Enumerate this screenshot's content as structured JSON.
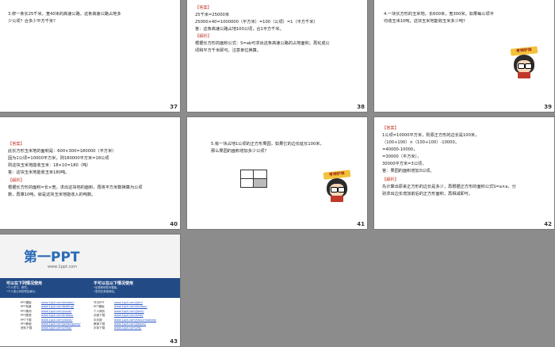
{
  "slides": [
    {
      "num": "37",
      "text": "3.修一条长25千米，宽40米的高速公路，这条高速公路占地多\n少公顷？合多少平方千米？"
    },
    {
      "num": "38",
      "answer_tag": "【答案】",
      "text": "25千米=25000米\n25000×40=1000000（平方米）=100（公顷）=1（平方千米）\n答：这条高速公路占地100公顷，合1平方千米。",
      "analysis_tag": "【解析】",
      "analysis": "根据长方形的面积公式：S=ab可求出这条高速公路的占地面积，再化成公\n顷和平方千米即可。注意单位换算。"
    },
    {
      "num": "39",
      "text": "4.一块长方形的玉米地，长600米，宽300米。如果每公顷平\n均收玉米10吨，这块玉米地能收玉米多少吨？"
    },
    {
      "num": "40",
      "answer_tag": "【答案】",
      "text": "此长方形玉米地的面积是：600×300=180000（平方米）\n因为1公顷=10000平方米，则180000平方米=18公顷\n则这块玉米地能收玉米：18×10=180（吨）\n答：这块玉米地能收玉米180吨。",
      "analysis_tag": "【解析】",
      "analysis": "根据长方形的面积=长×宽，求出这块地的面积，再将平方米数换算为公顷\n数，再乘10吨，就是这块玉米地能收入的吨数。"
    },
    {
      "num": "41",
      "text": "5.有一块占地1公顷的正方形果园，如果它的边长延长100米，\n那么果园的面积增加多少公顷？"
    },
    {
      "num": "42",
      "answer_tag": "【答案】",
      "text": "1公顷=10000平方米，则原正方形的边长是100米，\n（100+100）×（100+100）-10000，\n=40000-10000，\n=30000（平方米），\n30000平方米=3公顷，\n答：果园的面积增加3公顷。",
      "analysis_tag": "【解析】",
      "analysis": "先计算出原来正方形的边长是多少，再根据正方形的面积公式S=a×a，分\n别求出边长增加前后的正方形面积，再相减即可。"
    },
    {
      "num": "43"
    }
  ],
  "cartoon_label": "考神护体",
  "ppt": {
    "logo": "第一PPT",
    "url": "www.1ppt.com",
    "left_title": "可以在下列情况使用",
    "left_sub": "•个人学习、研究。\n•个人或公司的项目演示。",
    "right_title": "不可以在以下情况使用",
    "right_sub": "•出售和转售本模板。\n•发布在其他网站。",
    "left_list": "PPT模板\nPPT背景\nPPT素材\nPPT图表\nPPT下载\nPPT教程\n资料下载",
    "left_links": "www.1ppt.com/moban/\nwww.1ppt.com/beijing/\nwww.1ppt.com/sucai/\nwww.1ppt.com/tubiao/\nwww.1ppt.com/xiazai/\nwww.1ppt.com/powerpoint/\nwww.1ppt.com/ziliao/",
    "right_list": "节日PPT\n PPT模板\n个人简历\n试卷下载\n手抄报\n教案下载\n字体下载",
    "right_links": "www.1ppt.com/jieri/\nwww.1ppt.com/moban/\nwww.1ppt.com/jianli/\nwww.1ppt.com/shiti/\nwww.1ppt.com/shouchaobao/\nwww.1ppt.com/jiaoan/\nwww.1ppt.com/ziti/"
  }
}
